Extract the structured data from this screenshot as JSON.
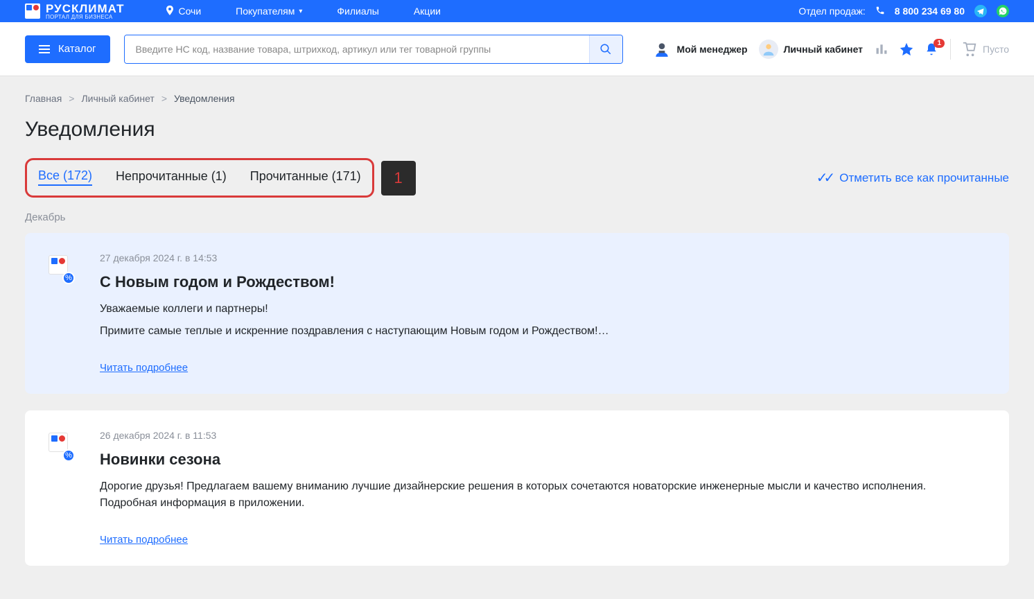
{
  "topbar": {
    "brand": "РУСКЛИМАТ",
    "brand_sub": "ПОРТАЛ ДЛЯ БИЗНЕСА",
    "city": "Сочи",
    "nav": {
      "buyers": "Покупателям",
      "branches": "Филиалы",
      "promo": "Акции"
    },
    "sales_label": "Отдел продаж:",
    "phone": "8 800 234 69 80"
  },
  "header": {
    "catalog": "Каталог",
    "search_placeholder": "Введите НС код, название товара, штрихкод, артикул или тег товарной группы",
    "manager": "Мой менеджер",
    "cabinet": "Личный кабинет",
    "bell_badge": "1",
    "cart_label": "Пусто"
  },
  "breadcrumb": {
    "home": "Главная",
    "cabinet": "Личный кабинет",
    "current": "Уведомления"
  },
  "page_title": "Уведомления",
  "tabs": {
    "all": "Все (172)",
    "unread": "Непрочитанные (1)",
    "read": "Прочитанные (171)",
    "callout": "1"
  },
  "mark_all": "Отметить все как прочитанные",
  "month": "Декабрь",
  "notifications": [
    {
      "date": "27 декабря 2024 г. в 14:53",
      "title": "С Новым годом и Рождеством!",
      "line1": "Уважаемые коллеги и партнеры!",
      "line2": "Примите самые теплые и искренние поздравления с наступающим Новым годом и Рождеством!…",
      "read_more": "Читать подробнее"
    },
    {
      "date": "26 декабря 2024 г. в 11:53",
      "title": "Новинки сезона",
      "line1": "Дорогие друзья! Предлагаем вашему вниманию лучшие дизайнерские решения в которых сочетаются новаторские инженерные мысли и качество исполнения. Подробная информация в приложении.",
      "line2": "",
      "read_more": "Читать подробнее"
    }
  ]
}
